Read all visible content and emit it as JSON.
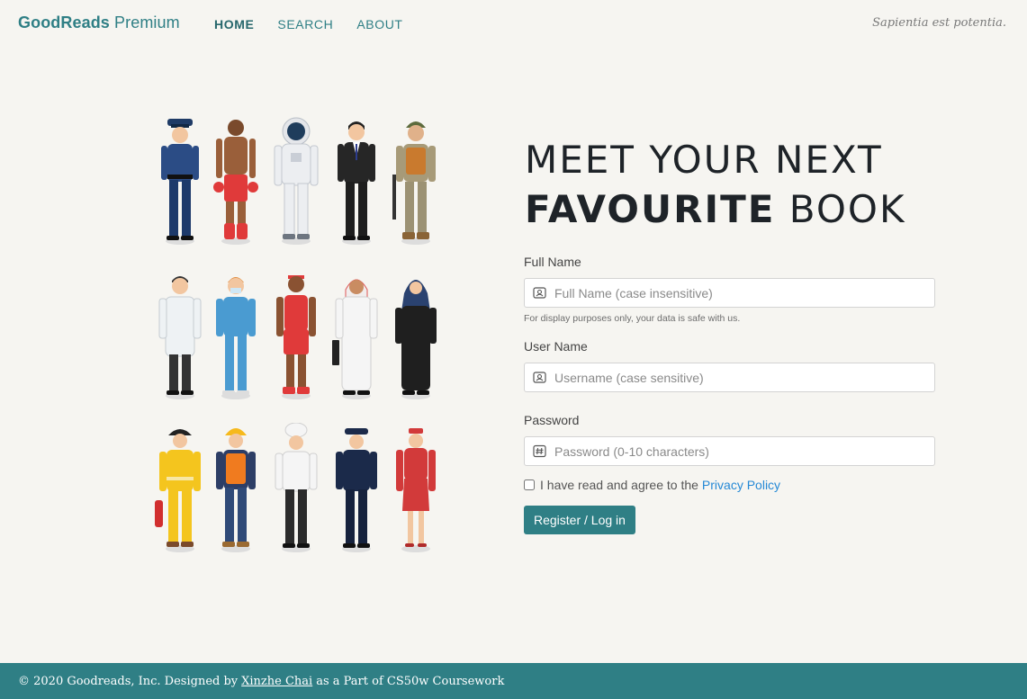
{
  "nav": {
    "brand_bold": "GoodReads",
    "brand_light": "Premium",
    "links": [
      {
        "label": "HOME",
        "active": true
      },
      {
        "label": "SEARCH",
        "active": false
      },
      {
        "label": "ABOUT",
        "active": false
      }
    ],
    "motto": "Sapientia est potentia."
  },
  "illustration": {
    "figures": [
      "police-officer",
      "boxer",
      "astronaut",
      "businessman",
      "soldier",
      "doctor",
      "nurse",
      "basketball-player",
      "arab-man",
      "woman-in-hijab",
      "firefighter",
      "construction-worker",
      "chef",
      "pilot",
      "flight-attendant"
    ]
  },
  "hero": {
    "line1": "MEET YOUR NEXT",
    "line2_bold": "FAVOURITE",
    "line2_rest": " BOOK"
  },
  "form": {
    "full_name": {
      "label": "Full Name",
      "placeholder": "Full Name (case insensitive)",
      "help": "For display purposes only, your data is safe with us.",
      "icon": "person-card-icon"
    },
    "user_name": {
      "label": "User Name",
      "placeholder": "Username (case sensitive)",
      "icon": "person-card-icon"
    },
    "password": {
      "label": "Password",
      "placeholder": "Password (0-10 characters)",
      "icon": "hash-icon"
    },
    "agree_text": "I have read and agree to the",
    "privacy_link": "Privacy Policy",
    "submit_label": "Register / Log in"
  },
  "footer": {
    "prefix": "© 2020 Goodreads, Inc. Designed by",
    "author": "Xinzhe Chai",
    "suffix": "as a Part of CS50w Coursework"
  },
  "colors": {
    "accent": "#2f7f85",
    "background": "#f6f5f1",
    "link": "#2589d6"
  }
}
